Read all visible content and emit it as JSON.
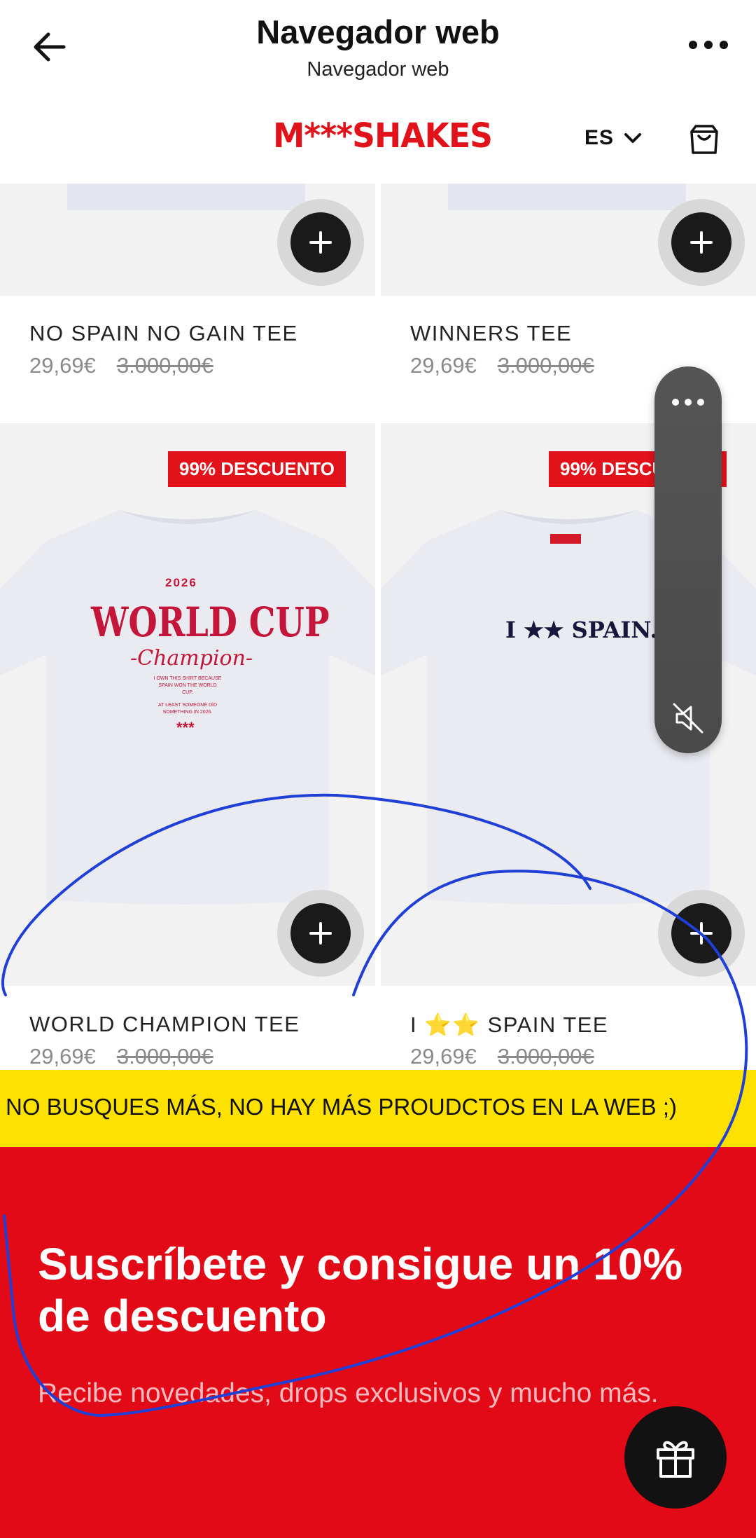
{
  "browser": {
    "title": "Navegador web",
    "subtitle": "Navegador web",
    "back_icon": "arrow-left-icon",
    "more_icon": "more-horizontal-icon"
  },
  "site": {
    "logo": "M***SHAKES",
    "language": "ES",
    "cart_icon": "shopping-bag-icon",
    "brand_color": "#e2121b"
  },
  "products": [
    {
      "name": "NO SPAIN NO GAIN TEE",
      "price": "29,69€",
      "old_price": "3.000,00€"
    },
    {
      "name": "WINNERS TEE",
      "price": "29,69€",
      "old_price": "3.000,00€"
    },
    {
      "name": "WORLD CHAMPION TEE",
      "price": "29,69€",
      "old_price": "3.000,00€",
      "badge": "99% DESCUENTO",
      "print": {
        "year": "2026",
        "headline": "WORLD CUP",
        "script": "-Champion-",
        "small1": "I OWN THIS SHIRT BECAUSE SPAIN WON THE WORLD CUP.",
        "small2": "AT LEAST SOMEONE DID SOMETHING IN 2026.",
        "stamp": "***"
      }
    },
    {
      "name": "I ⭐⭐ SPAIN TEE",
      "price": "29,69€",
      "old_price": "3.000,00€",
      "badge": "99% DESCUENTO",
      "print": {
        "text": "I ★★ SPAIN."
      }
    }
  ],
  "marquee": {
    "text": "NO BUSQUES MÁS, NO HAY MÁS PROUDCTOS EN LA WEB ;)",
    "color": "#fde100"
  },
  "newsletter": {
    "title": "Suscríbete y consigue un 10% de descuento",
    "description": "Recibe novedades, drops exclusivos y mucho más.",
    "background": "#e30a18",
    "gift_icon": "gift-icon"
  },
  "floating_widget": {
    "more_icon": "more-horizontal-icon",
    "mute_icon": "speaker-muted-icon"
  },
  "annotation_color": "#1f3fd6"
}
